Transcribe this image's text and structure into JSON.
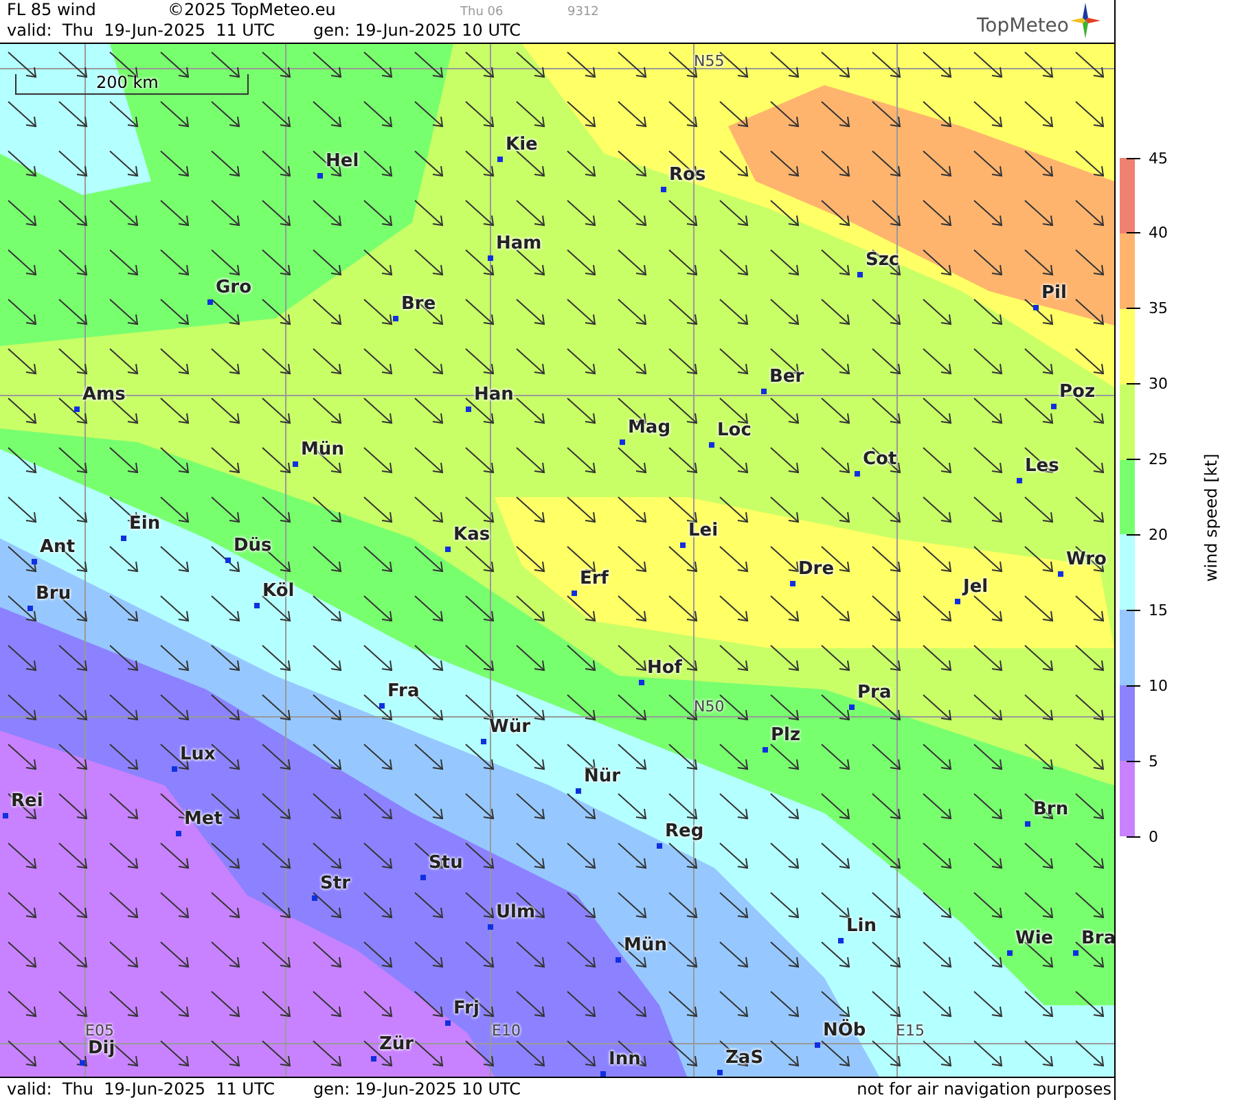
{
  "header": {
    "title": "FL 85 wind",
    "copyright": "©2025 TopMeteo.eu",
    "day": "Thu 06",
    "code": "9312",
    "valid": "valid:  Thu  19-Jun-2025  11 UTC",
    "generated": "gen: 19-Jun-2025 10 UTC",
    "logo": "TopMeteo"
  },
  "map": {
    "scale": "200 km",
    "grid_labels": [
      "N55",
      "N50",
      "E05",
      "E10",
      "E15"
    ],
    "cities": [
      "Hel",
      "Kie",
      "Ros",
      "Ham",
      "Szc",
      "Gro",
      "Bre",
      "Pil",
      "Ams",
      "Han",
      "Ber",
      "Poz",
      "Mag",
      "Loc",
      "Mün",
      "Cot",
      "Les",
      "Ein",
      "Kas",
      "Lei",
      "Ant",
      "Düs",
      "Dre",
      "Wro",
      "Bru",
      "Köl",
      "Erf",
      "Jel",
      "Hof",
      "Fra",
      "Pra",
      "Wür",
      "Plz",
      "Lux",
      "Nür",
      "Rei",
      "Met",
      "Reg",
      "Brn",
      "Stu",
      "Str",
      "Ulm",
      "Lin",
      "Mün",
      "Wie",
      "Bra",
      "Frj",
      "NÖb",
      "Dij",
      "Zür",
      "Inn",
      "ZaS"
    ]
  },
  "legend": {
    "title": "wind speed [kt]",
    "ticks": [
      "45",
      "40",
      "35",
      "30",
      "25",
      "20",
      "15",
      "10",
      "5",
      "0"
    ],
    "bands": [
      {
        "color": "#f08070"
      },
      {
        "color": "#ffb46e"
      },
      {
        "color": "#ffff66"
      },
      {
        "color": "#c8ff66"
      },
      {
        "color": "#78ff6e"
      },
      {
        "color": "#b4ffff"
      },
      {
        "color": "#96c8ff"
      },
      {
        "color": "#8c82ff"
      },
      {
        "color": "#c882ff"
      }
    ]
  },
  "footer": {
    "valid": "valid:  Thu  19-Jun-2025  11 UTC",
    "generated": "gen: 19-Jun-2025 10 UTC",
    "notice": "not for air navigation purposes"
  }
}
